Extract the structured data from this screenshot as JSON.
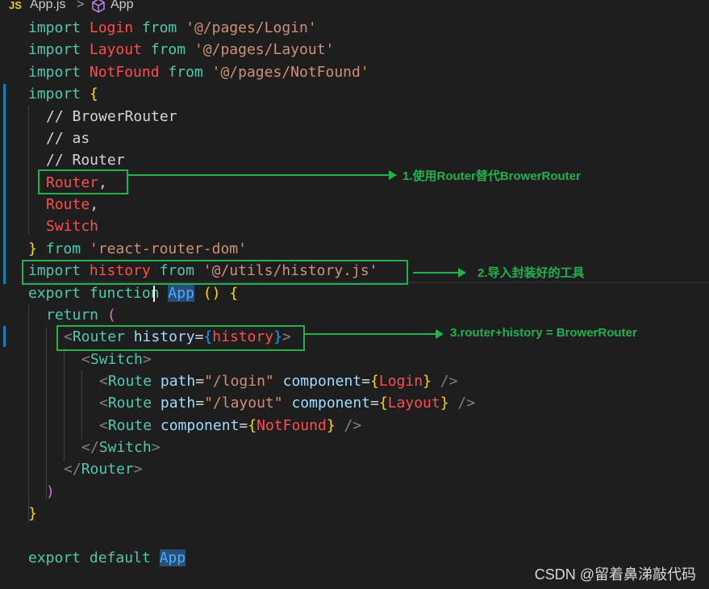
{
  "breadcrumb": {
    "lang_badge": "JS",
    "file": "App.js",
    "separator": ">",
    "symbol": "App"
  },
  "code": {
    "l1": {
      "kw": "import",
      "id": "Login",
      "from": "from",
      "str": "'@/pages/Login'"
    },
    "l2": {
      "kw": "import",
      "id": "Layout",
      "from": "from",
      "str": "'@/pages/Layout'"
    },
    "l3": {
      "kw": "import",
      "id": "NotFound",
      "from": "from",
      "str": "'@/pages/NotFound'"
    },
    "l4": {
      "kw": "import",
      "brace": "{"
    },
    "l5": "// BrowerRouter",
    "l6": "// as",
    "l7": "// Router",
    "l8": {
      "id": "Router",
      "punc": ","
    },
    "l9": {
      "id": "Route",
      "punc": ","
    },
    "l10": {
      "id": "Switch"
    },
    "l11": {
      "brace": "}",
      "from": "from",
      "str": "'react-router-dom'"
    },
    "l12": {
      "kw": "import",
      "id": "history",
      "from": "from",
      "str": "'@/utils/history.js'"
    },
    "l13": {
      "kw1": "export",
      "kw2": "function",
      "name": "App",
      "parens": "()",
      "brace": "{"
    },
    "l14": {
      "kw": "return",
      "paren": "("
    },
    "l15": {
      "open": "<",
      "tag": "Router",
      "attr": "history",
      "eq": "=",
      "lb": "{",
      "val": "history",
      "rb": "}",
      "close": ">"
    },
    "l16": {
      "open": "<",
      "tag": "Switch",
      "close": ">"
    },
    "l17": {
      "open": "<",
      "tag": "Route",
      "attr1": "path",
      "eq1": "=",
      "str": "\"/login\"",
      "attr2": "component",
      "eq2": "=",
      "lb": "{",
      "val": "Login",
      "rb": "}",
      "close": "/>"
    },
    "l18": {
      "open": "<",
      "tag": "Route",
      "attr1": "path",
      "eq1": "=",
      "str": "\"/layout\"",
      "attr2": "component",
      "eq2": "=",
      "lb": "{",
      "val": "Layout",
      "rb": "}",
      "close": "/>"
    },
    "l19": {
      "open": "<",
      "tag": "Route",
      "attr2": "component",
      "eq2": "=",
      "lb": "{",
      "val": "NotFound",
      "rb": "}",
      "close": "/>"
    },
    "l20": {
      "open": "</",
      "tag": "Switch",
      "close": ">"
    },
    "l21": {
      "open": "</",
      "tag": "Router",
      "close": ">"
    },
    "l22": ")",
    "l23": "}",
    "l25": {
      "kw1": "export",
      "kw2": "default",
      "name": "App"
    }
  },
  "annotations": {
    "note1": "1.使用Router替代BrowerRouter",
    "note2": "2.导入封装好的工具",
    "note3": "3.router+history = BrowerRouter"
  },
  "colors": {
    "annotation": "#22b14c",
    "keyword": "#4ec9b0",
    "identifier": "#ff4d4d",
    "string": "#ce9178"
  },
  "watermark": "CSDN @留着鼻涕敲代码"
}
